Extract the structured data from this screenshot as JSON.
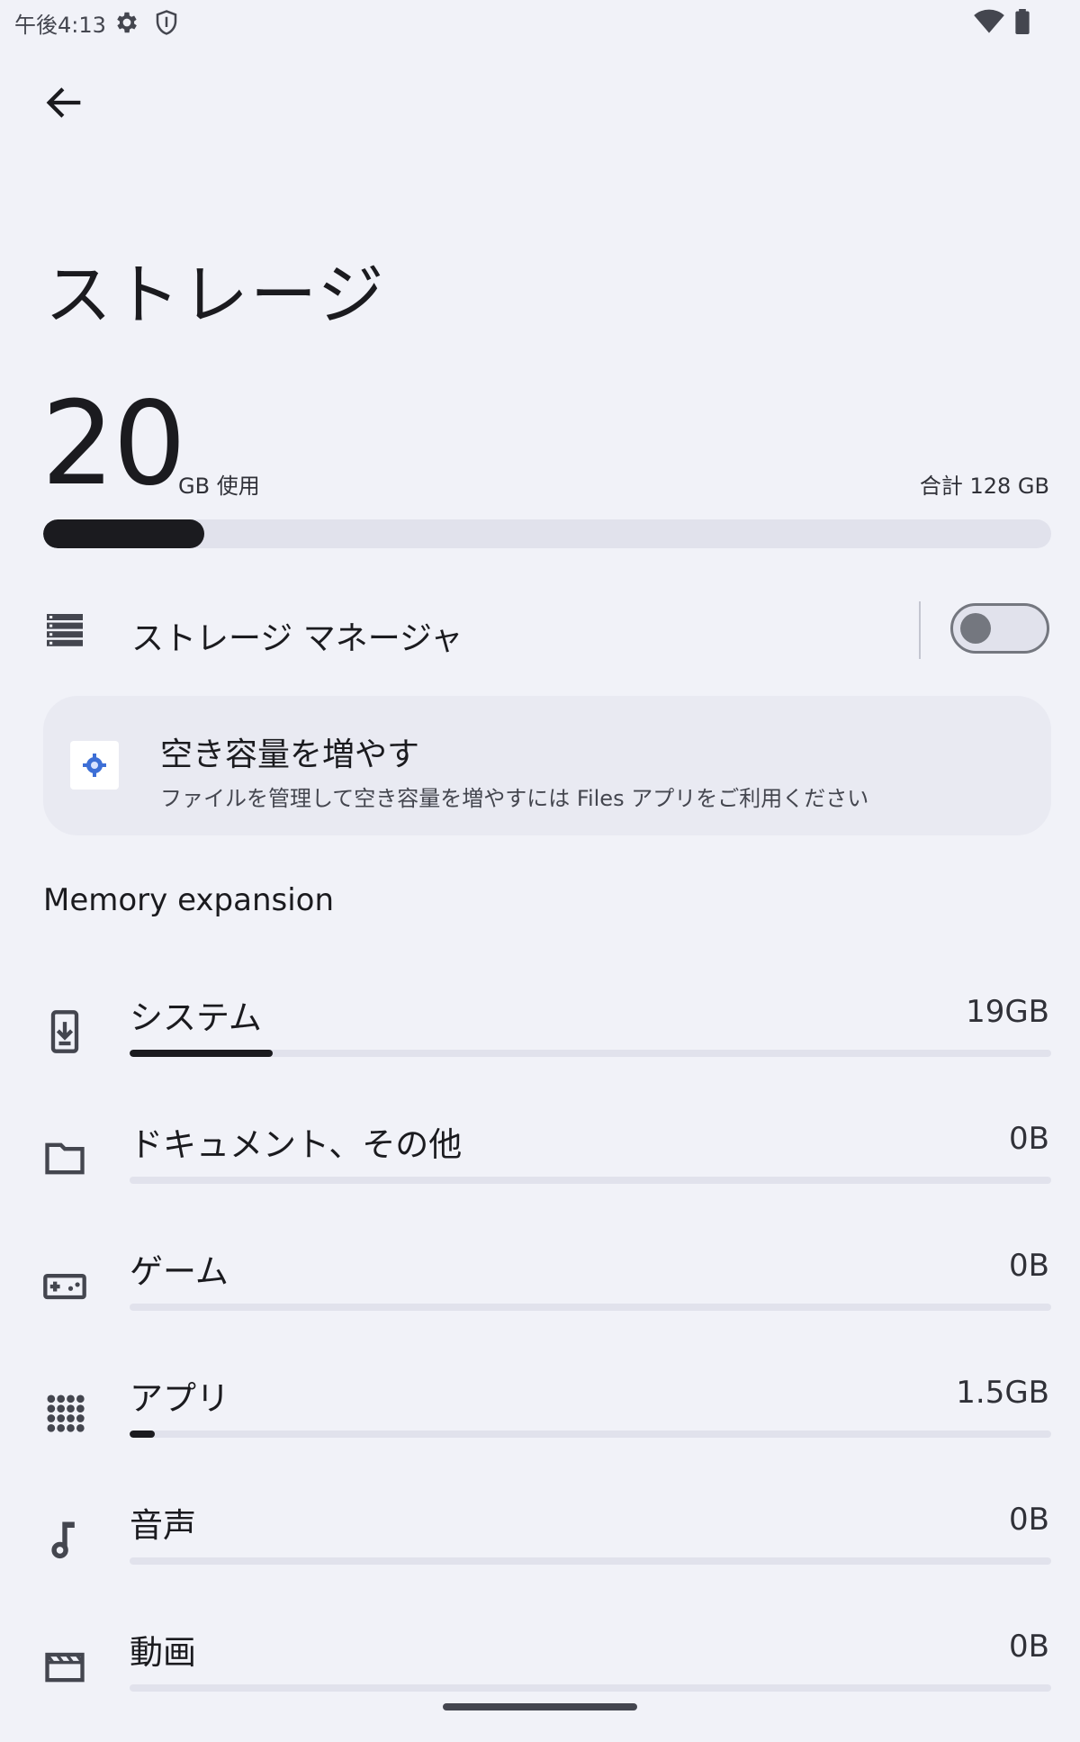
{
  "status_bar": {
    "time": "午後4:13",
    "icons": [
      "gear-icon",
      "shield-icon",
      "wifi-icon",
      "battery-icon"
    ]
  },
  "header": {
    "back_icon": "arrow-back-icon",
    "title": "ストレージ"
  },
  "usage": {
    "used_value": "20",
    "used_unit": "GB 使用",
    "total": "合計 128 GB",
    "used_fraction": 0.16
  },
  "storage_manager": {
    "label": "ストレージ マネージャ",
    "enabled": false
  },
  "free_space_card": {
    "title": "空き容量を増やす",
    "subtitle": "ファイルを管理して空き容量を増やすには Files アプリをご利用ください"
  },
  "section_header": "Memory expansion",
  "categories": [
    {
      "icon": "system-update-icon",
      "label": "システム",
      "size": "19GB",
      "fraction": 0.155
    },
    {
      "icon": "folder-icon",
      "label": "ドキュメント、その他",
      "size": "0B",
      "fraction": 0
    },
    {
      "icon": "gamepad-icon",
      "label": "ゲーム",
      "size": "0B",
      "fraction": 0
    },
    {
      "icon": "apps-grid-icon",
      "label": "アプリ",
      "size": "1.5GB",
      "fraction": 0.027
    },
    {
      "icon": "music-note-icon",
      "label": "音声",
      "size": "0B",
      "fraction": 0
    },
    {
      "icon": "movie-icon",
      "label": "動画",
      "size": "0B",
      "fraction": 0
    }
  ],
  "colors": {
    "background": "#f1f2f8",
    "text": "#1b1b1f",
    "track": "#e1e2ec",
    "fill": "#1b1b1f",
    "card": "#e9eaf2"
  }
}
